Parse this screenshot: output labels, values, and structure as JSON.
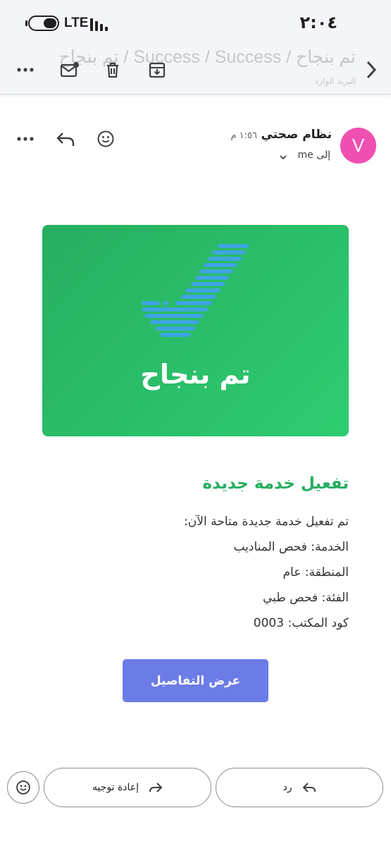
{
  "status_bar": {
    "time": "٢:٠٤",
    "network": "LTE"
  },
  "toolbar": {
    "subject_ghost": "تم بنجاح / Success / Success / تم بنجاح",
    "folder_ghost": "البريد الوارد"
  },
  "email": {
    "avatar_letter": "V",
    "sender": "نظام صحتي",
    "time": "١:٥٦ م",
    "to_label": "إلى me"
  },
  "banner": {
    "title": "تم بنجاح"
  },
  "content": {
    "heading": "تفعيل خدمة جديدة",
    "lines": [
      "تم تفعيل خدمة جديدة متاحة الآن:",
      "الخدمة: فحص المناديب",
      "المنطقة: عام",
      "الفئة: فحص طبي",
      "كود المكتب: 0003"
    ],
    "button": "عرض التفاصيل"
  },
  "actions": {
    "reply": "رد",
    "forward": "إعادة توجيه"
  },
  "colors": {
    "accent_green": "#27ae60",
    "button_blue": "#6c7ce7",
    "avatar_pink": "#f04fb2"
  }
}
